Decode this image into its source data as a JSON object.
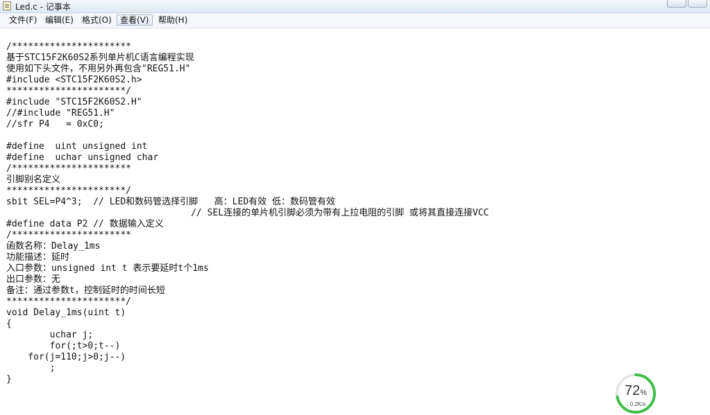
{
  "window": {
    "title": "Led.c - 记事本"
  },
  "menu": [
    {
      "label": "文件(F)"
    },
    {
      "label": "编辑(E)"
    },
    {
      "label": "格式(O)"
    },
    {
      "label": "查看(V)"
    },
    {
      "label": "帮助(H)"
    }
  ],
  "editor": {
    "content": "/**********************\n基于STC15F2K60S2系列单片机C语言编程实现\n使用如下头文件，不用另外再包含\"REG51.H\"\n#include <STC15F2K60S2.h>\n**********************/\n#include \"STC15F2K60S2.H\"\n//#include \"REG51.H\"\n//sfr P4   = 0xC0;\n\n#define  uint unsigned int\n#define  uchar unsigned char\n/**********************\n引脚别名定义\n**********************/\nsbit SEL=P4^3;  // LED和数码管选择引脚   高：LED有效 低：数码管有效\n                                  // SEL连接的单片机引脚必须为带有上拉电阻的引脚 或将其直接连接VCC\n#define data P2 // 数据输入定义\n/**********************\n函数名称：Delay_1ms\n功能描述：延时\n入口参数：unsigned int t 表示要延时t个1ms\n出口参数：无\n备注：通过参数t，控制延时的时间长短\n**********************/\nvoid Delay_1ms(uint t)\n{\n        uchar j;\n        for(;t>0;t--)\n    for(j=110;j>0;j--)\n        ;\n}"
  },
  "network_widget": {
    "percent": "72",
    "percent_unit": "%",
    "percent_value": 72,
    "speed_arrow": "↓",
    "speed": "0.2K/s",
    "ring_color": "#3fbf4a",
    "track_color": "#e6e6e6"
  }
}
